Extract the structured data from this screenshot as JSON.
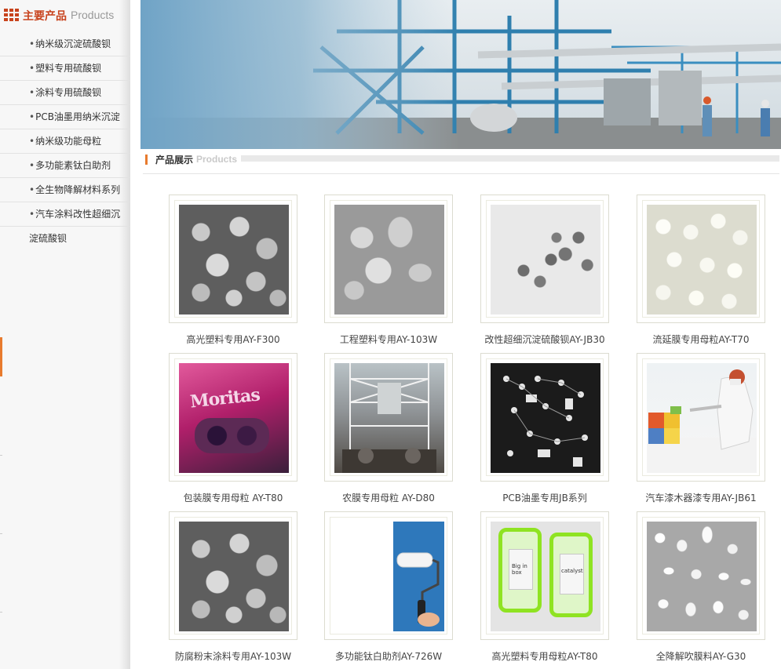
{
  "sidebar": {
    "title_cn": "主要产品",
    "title_en": "Products",
    "items": [
      {
        "label": "纳米级沉淀硫酸钡"
      },
      {
        "label": "塑料专用硫酸钡"
      },
      {
        "label": "涂料专用硫酸钡"
      },
      {
        "label": "PCB油墨用纳米沉淀"
      },
      {
        "label": "纳米级功能母粒"
      },
      {
        "label": "多功能素钛白助剂"
      },
      {
        "label": "全生物降解材料系列"
      },
      {
        "label": "汽车涂料改性超细沉"
      }
    ],
    "item_bullet": "•",
    "wrap_tail": "淀硫酸钡"
  },
  "section": {
    "title_cn": "产品展示",
    "title_en": "Products"
  },
  "products": [
    {
      "caption": "高光塑料专用AY-F300",
      "image": "sem-micrograph"
    },
    {
      "caption": "工程塑料专用AY-103W",
      "image": "sem-micrograph-platelets"
    },
    {
      "caption": "改性超细沉淀硫酸钡AY-JB30",
      "image": "tem-micrograph"
    },
    {
      "caption": "流延膜专用母粒AY-T70",
      "image": "white-pellets"
    },
    {
      "caption": "包装膜专用母粒 AY-T80",
      "image": "candy-package"
    },
    {
      "caption": "农膜专用母粒 AY-D80",
      "image": "factory-interior"
    },
    {
      "caption": "PCB油墨专用JB系列",
      "image": "pcb-board"
    },
    {
      "caption": "汽车漆木器漆专用AY-JB61",
      "image": "spray-painter"
    },
    {
      "caption": "防腐粉末涂料专用AY-103W",
      "image": "sem-micrograph"
    },
    {
      "caption": "多功能钛白助剂AY-726W",
      "image": "paint-roller"
    },
    {
      "caption": "高光塑料专用母粒AY-T80",
      "image": "green-phone-cases"
    },
    {
      "caption": "全降解吹膜料AY-G30",
      "image": "white-pellets-small"
    }
  ],
  "image_text": {
    "candy_brand": "Moritas",
    "case_left": "Big in box",
    "case_right": "catalyst"
  },
  "colors": {
    "accent": "#e87b2e",
    "title_red": "#c8431d"
  }
}
